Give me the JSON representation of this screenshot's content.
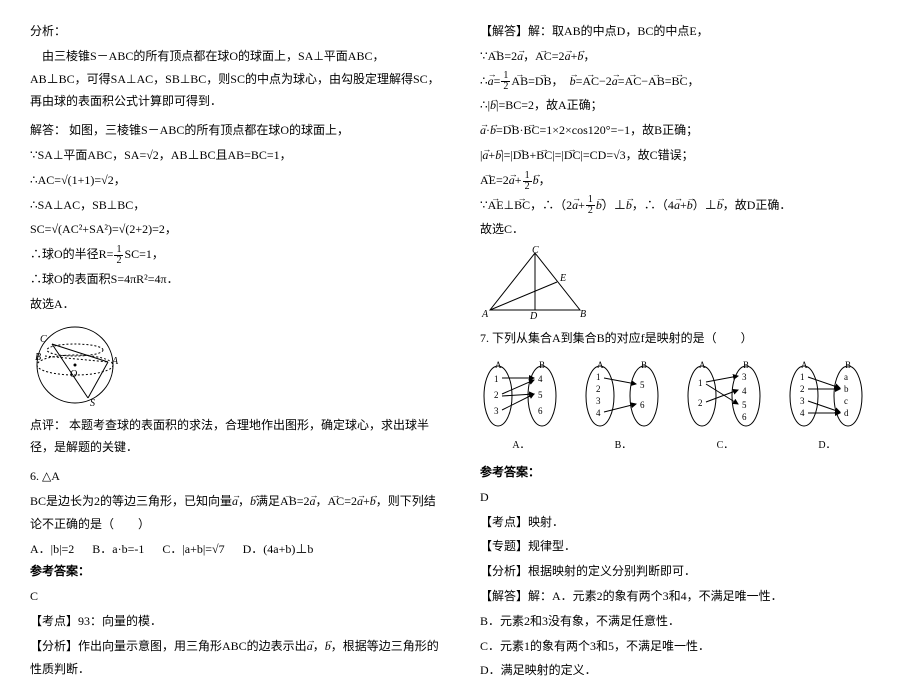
{
  "left": {
    "analysis_label": "分析：",
    "analysis_text": "由三棱锥S－ABC的所有顶点都在球O的球面上，SA⊥平面ABC，AB⊥BC，可得SA⊥AC，SB⊥BC，则SC的中点为球心，由勾股定理解得SC，再由球的表面积公式计算即可得到．",
    "solve_intro": "解答：  如图，三棱锥S－ABC的所有顶点都在球O的球面上，",
    "given1": "∵SA⊥平面ABC，SA=√2，AB⊥BC且AB=BC=1，",
    "ac_calc": "∴AC=√(1+1)=√2，",
    "perp": "∴SA⊥AC，SB⊥BC，",
    "sc_calc": "SC=√(AC²+SA²)=√(2+2)=2，",
    "radius": "∴球O的半径R= ½ SC=1，",
    "surface": "∴球O的表面积S=4πR²=4π．",
    "answer_a": "故选A．",
    "comment": "点评：  本题考查球的表面积的求法，合理地作出图形，确定球心，求出球半径，是解题的关键．",
    "q6_line1": "6. △A",
    "q6_line2_a": "BC是边长为2的等边三角形，已知向量",
    "q6_a": "a",
    "q6_comma": "，",
    "q6_b": "b",
    "q6_line2_b": "满足",
    "q6_ab": "AB",
    "q6_eq": "=2",
    "q6_a2": "a",
    "q6_c2": "，",
    "q6_ac": "AC",
    "q6_eq2": "=2",
    "q6_a3": "a",
    "q6_plus": "+",
    "q6_b2": "b",
    "q6_tail": "，则下列结论不正确的是（　　）",
    "opt_a": "A．|b|=2",
    "opt_b": "B．a·b=-1",
    "opt_c": "C．|a+b|=√7",
    "opt_d": "D．(4a+b)⊥b",
    "ref_ans": "参考答案：",
    "ans_c": "C",
    "kaodian": "【考点】93：向量的模．",
    "fenxi_label": "【分析】作出向量示意图，用三角形ABC的边表示出",
    "fenxi_a": "a",
    "fenxi_comma": "，",
    "fenxi_b": "b",
    "fenxi_tail": "，根据等边三角形的性质判断．"
  },
  "right": {
    "jieda": "【解答】解：取AB的中点D，BC的中点E，",
    "r1": "∵AB=2a，AC=2a+b，",
    "r2": "∴a=½AB=DB，  b=AC−2a=AC−AB=BC，",
    "r3": "∴|b|=BC=2，故A正确；",
    "r4": "a·b=DB·BC=1×2×cos120°=−1，故B正确；",
    "r5": "|a+b|=|DB+BC|=|DC|=CD=√3，故C错误；",
    "r6": "AE=2a+½b，",
    "r7": "∵AE⊥BC，∴（2a+½b）⊥b，∴（4a+b）⊥b，故D正确．",
    "r8": "故选C．",
    "q7": "7. 下列从集合A到集合B的对应f是映射的是（　　）",
    "map_a": "A．",
    "map_b": "B．",
    "map_c": "C．",
    "map_d": "D．",
    "ref_ans": "参考答案：",
    "ans_d": "D",
    "kaodian2": "【考点】映射．",
    "zhuanti": "【专题】规律型．",
    "fenxi2": "【分析】根据映射的定义分别判断即可．",
    "jieda2": "【解答】解：A．元素2的象有两个3和4，不满足唯一性．",
    "jb": "B．元素2和3没有象，不满足任意性．",
    "jc": "C．元素1的象有两个3和5，不满足唯一性．",
    "jd": "D．满足映射的定义．"
  }
}
